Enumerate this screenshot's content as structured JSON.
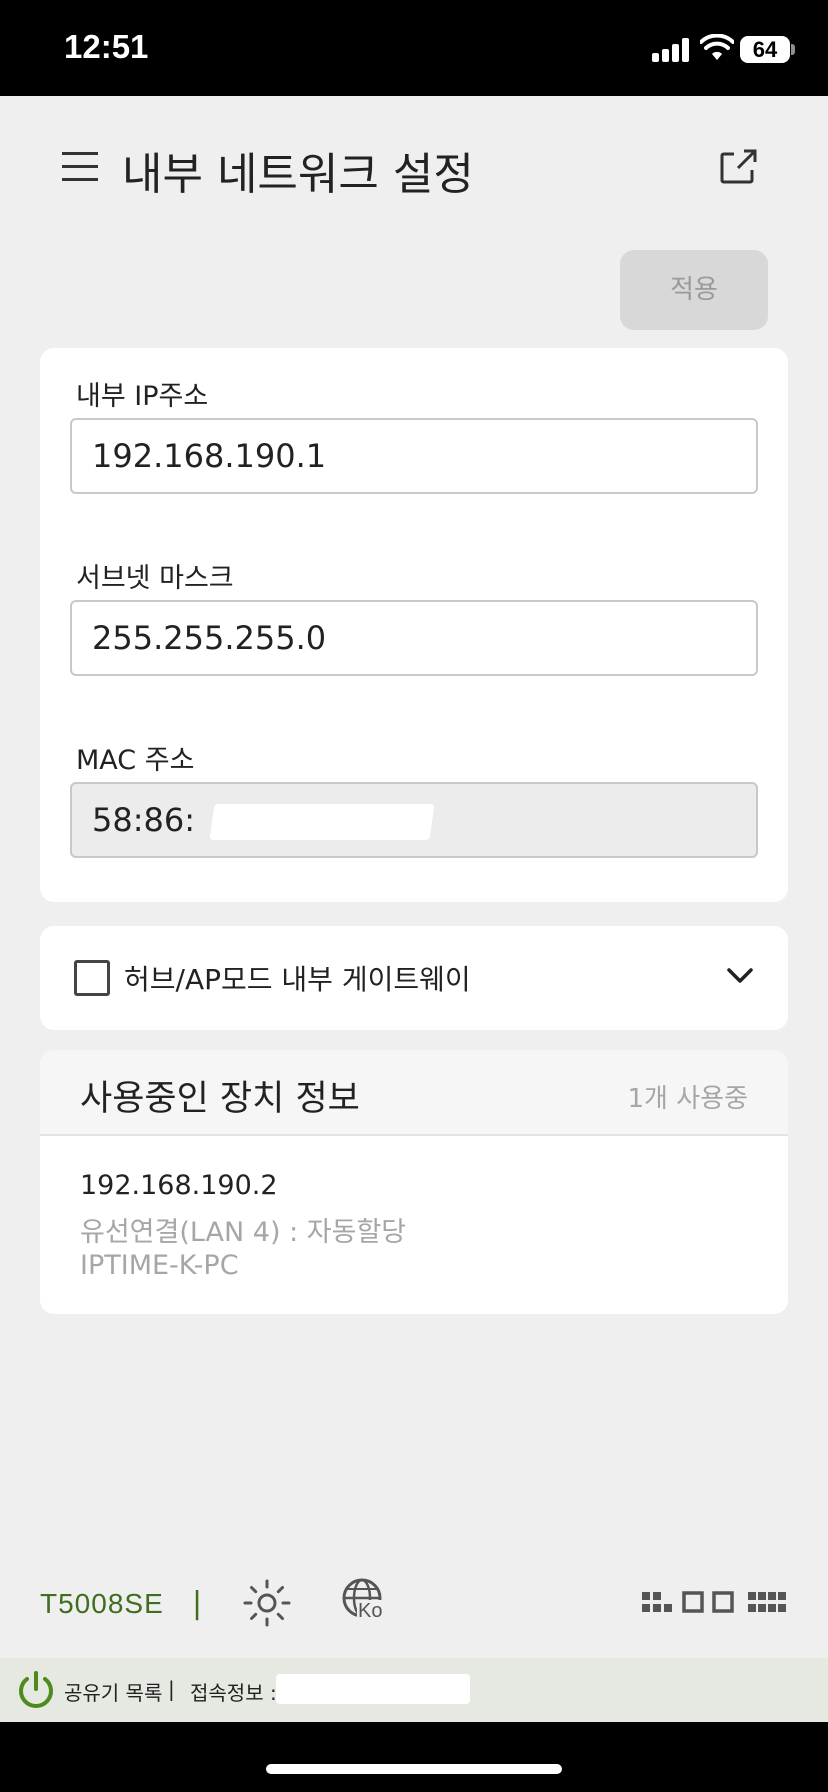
{
  "status_bar": {
    "time": "12:51",
    "battery": "64"
  },
  "header": {
    "title": "내부 네트워크 설정",
    "apply_label": "적용"
  },
  "network": {
    "ip_label": "내부 IP주소",
    "ip_value": "192.168.190.1",
    "subnet_label": "서브넷 마스크",
    "subnet_value": "255.255.255.0",
    "mac_label": "MAC 주소",
    "mac_value": "58:86:"
  },
  "hub_mode": {
    "label": "허브/AP모드 내부 게이트웨이",
    "checked": false
  },
  "devices": {
    "title": "사용중인 장치 정보",
    "count": "1개 사용중",
    "items": [
      {
        "ip": "192.168.190.2",
        "connection": "유선연결(LAN 4) : 자동할당",
        "name": "IPTIME-K-PC"
      }
    ]
  },
  "footer": {
    "model": "T5008SE",
    "separator": "|",
    "language": "Ko"
  },
  "bottom_info": {
    "router_list": "공유기 목록",
    "separator": "|",
    "connection_info": "접속정보 :"
  },
  "colors": {
    "brand_green": "#3f6e1f",
    "background": "#efefef",
    "card": "#ffffff",
    "disabled_button": "#d8d8d8"
  }
}
